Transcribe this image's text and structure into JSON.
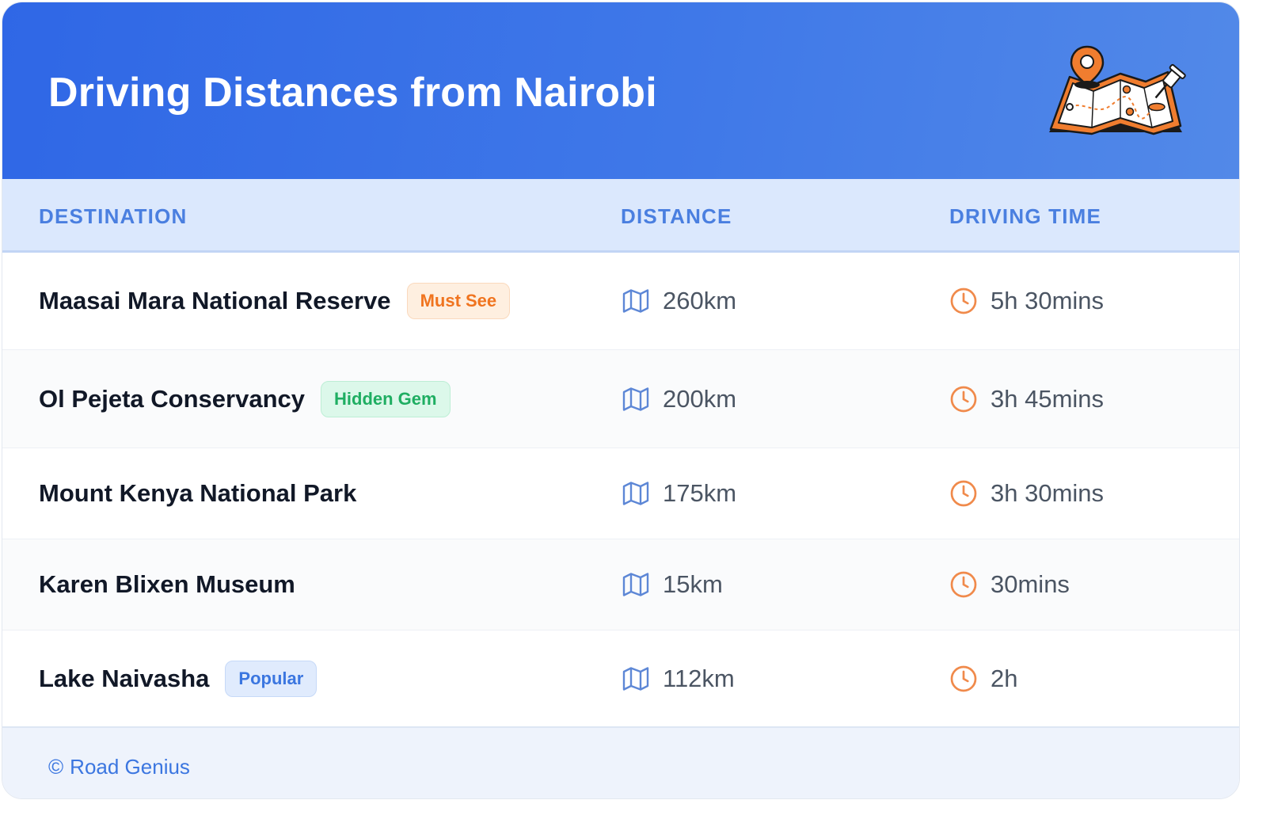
{
  "title": "Driving Distances from Nairobi",
  "columns": {
    "destination": "DESTINATION",
    "distance": "DISTANCE",
    "driving_time": "DRIVING TIME"
  },
  "rows": [
    {
      "destination": "Maasai Mara National Reserve",
      "badge": "Must See",
      "badge_style": "orange",
      "distance": "260km",
      "time": "5h 30mins"
    },
    {
      "destination": "Ol Pejeta Conservancy",
      "badge": "Hidden Gem",
      "badge_style": "green",
      "distance": "200km",
      "time": "3h 45mins"
    },
    {
      "destination": "Mount Kenya National Park",
      "badge": "",
      "badge_style": "",
      "distance": "175km",
      "time": "3h 30mins"
    },
    {
      "destination": "Karen Blixen Museum",
      "badge": "",
      "badge_style": "",
      "distance": "15km",
      "time": "30mins"
    },
    {
      "destination": "Lake Naivasha",
      "badge": "Popular",
      "badge_style": "blue",
      "distance": "112km",
      "time": "2h"
    }
  ],
  "footer": {
    "copyright_symbol": "©",
    "brand": "Road Genius"
  },
  "icons": {
    "distance": "map-icon",
    "time": "clock-icon",
    "header": "map-pin-illustration"
  },
  "colors": {
    "header_start": "#2f67e6",
    "header_end": "#5289e8",
    "accent_blue": "#4a7fe0",
    "accent_orange": "#f08a4b",
    "badge_orange_bg": "#feefe0",
    "badge_orange_text": "#f0741f",
    "badge_green_bg": "#dcf8ea",
    "badge_green_text": "#1fae62",
    "badge_blue_bg": "#e0ebfd",
    "badge_blue_text": "#3b76e0"
  }
}
